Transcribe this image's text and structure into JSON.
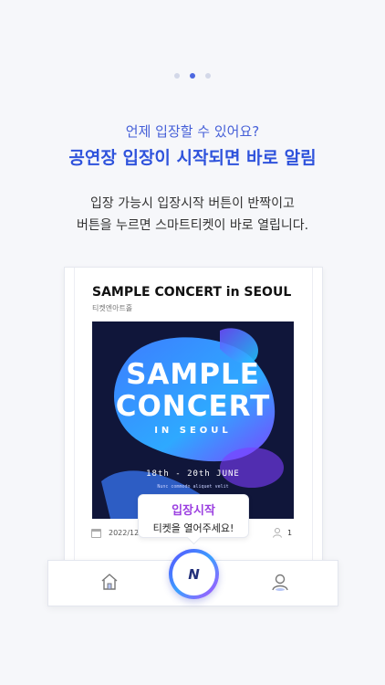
{
  "pagination": {
    "count": 3,
    "active_index": 1
  },
  "header": {
    "subtitle": "언제 입장할 수 있어요?",
    "title": "공연장 입장이 시작되면 바로 알림",
    "desc_line1": "입장 가능시 입장시작 버튼이 반짝이고",
    "desc_line2": "버튼을 누르면 스마트티켓이 바로 열립니다."
  },
  "ticket": {
    "concert_title": "SAMPLE CONCERT in SEOUL",
    "venue": "티켓엔아트홀",
    "poster": {
      "line1": "SAMPLE",
      "line2": "CONCERT",
      "line3": "IN SEOUL",
      "dates": "18th - 20th JUNE",
      "small_text": "Nunc commodo aliquet velit"
    },
    "date": "2022/12/",
    "count": "1"
  },
  "tooltip": {
    "title": "입장시작",
    "subtitle": "티켓을 열어주세요!"
  },
  "tabbar": {
    "home_icon": "home-icon",
    "center_logo": "N",
    "profile_icon": "person-icon"
  },
  "colors": {
    "accent": "#2f53dc",
    "tooltip_title": "#9b3fe0",
    "background": "#f6f7fa"
  }
}
